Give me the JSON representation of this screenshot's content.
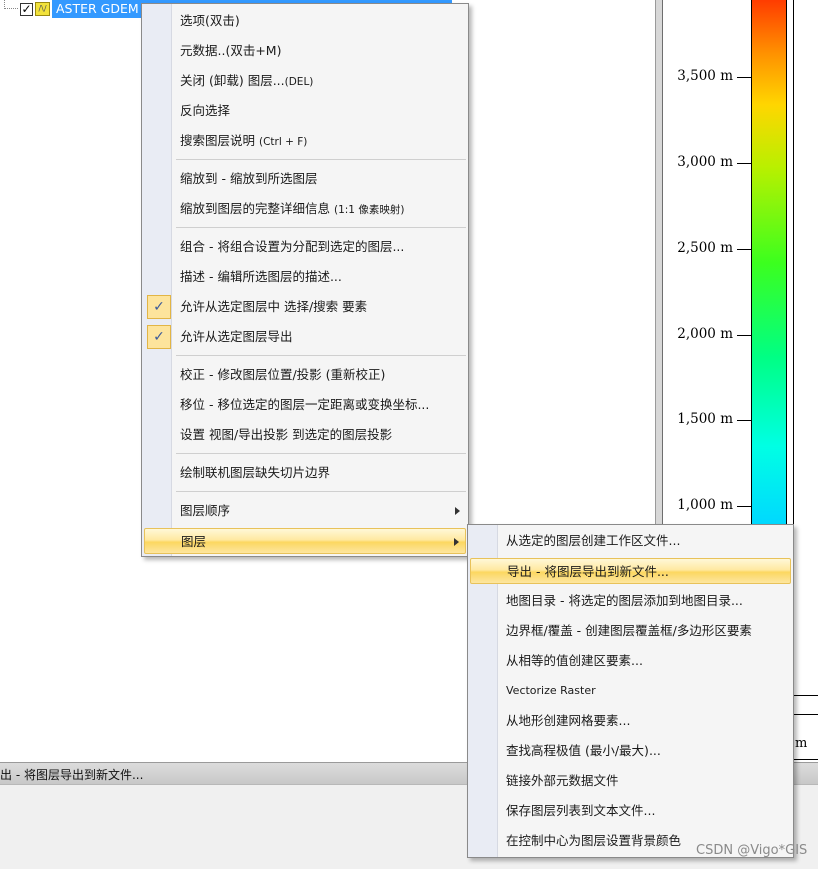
{
  "layer_tree": {
    "layer": {
      "label": "ASTER GDEM v",
      "checked_mark": "✓"
    }
  },
  "legend": {
    "ticks": [
      {
        "label": "3,500 m",
        "value": 3500
      },
      {
        "label": "3,000 m",
        "value": 3000
      },
      {
        "label": "2,500 m",
        "value": 2500
      },
      {
        "label": "2,000 m",
        "value": 2000
      },
      {
        "label": "1,500 m",
        "value": 1500
      },
      {
        "label": "1,000 m",
        "value": 1000
      }
    ],
    "unit_fragment": "m"
  },
  "status_bar": {
    "text": "出 - 将图层导出到新文件..."
  },
  "context_menu": {
    "items": [
      {
        "label": "选项(双击)",
        "hint": ""
      },
      {
        "label": "元数据..(双击+M)",
        "hint": ""
      },
      {
        "label": "关闭 (卸载) 图层...",
        "hint": "(DEL)"
      },
      {
        "label": "反向选择",
        "hint": ""
      },
      {
        "label": "搜索图层说明 ",
        "hint": "(Ctrl + F)"
      },
      {
        "label": "缩放到 - 缩放到所选图层",
        "hint": ""
      },
      {
        "label": "缩放到图层的完整详细信息 ",
        "hint": "(1:1 像素映射)"
      },
      {
        "label": "组合 - 将组合设置为分配到选定的图层...",
        "hint": ""
      },
      {
        "label": "描述 - 编辑所选图层的描述...",
        "hint": ""
      },
      {
        "label": "允许从选定图层中 选择/搜索 要素",
        "hint": "",
        "checked": true
      },
      {
        "label": "允许从选定图层导出",
        "hint": "",
        "checked": true
      },
      {
        "label": "校正 - 修改图层位置/投影 (重新校正)",
        "hint": ""
      },
      {
        "label": "移位 - 移位选定的图层一定距离或变换坐标...",
        "hint": ""
      },
      {
        "label": "设置 视图/导出投影 到选定的图层投影",
        "hint": ""
      },
      {
        "label": "绘制联机图层缺失切片边界",
        "hint": ""
      },
      {
        "label": "图层顺序",
        "hint": "",
        "submenu": true
      },
      {
        "label": "图层",
        "hint": "",
        "submenu": true,
        "highlight": true
      }
    ],
    "check_glyph": "✓"
  },
  "layer_submenu": {
    "items": [
      {
        "label": "从选定的图层创建工作区文件..."
      },
      {
        "label": "导出 - 将图层导出到新文件...",
        "highlight": true
      },
      {
        "label": "地图目录 - 将选定的图层添加到地图目录..."
      },
      {
        "label": "边界框/覆盖 - 创建图层覆盖框/多边形区要素"
      },
      {
        "label": "从相等的值创建区要素..."
      },
      {
        "label": "Vectorize Raster"
      },
      {
        "label": "从地形创建网格要素..."
      },
      {
        "label": "查找高程极值 (最小/最大)..."
      },
      {
        "label": "链接外部元数据文件"
      },
      {
        "label": "保存图层列表到文本文件..."
      },
      {
        "label": "在控制中心为图层设置背景颜色"
      }
    ]
  },
  "watermark": "CSDN @Vigo*GIS",
  "colors": {
    "selection": "#3399ff",
    "menu_highlight": "#fcd760",
    "menu_background": "#f5f5f5"
  }
}
